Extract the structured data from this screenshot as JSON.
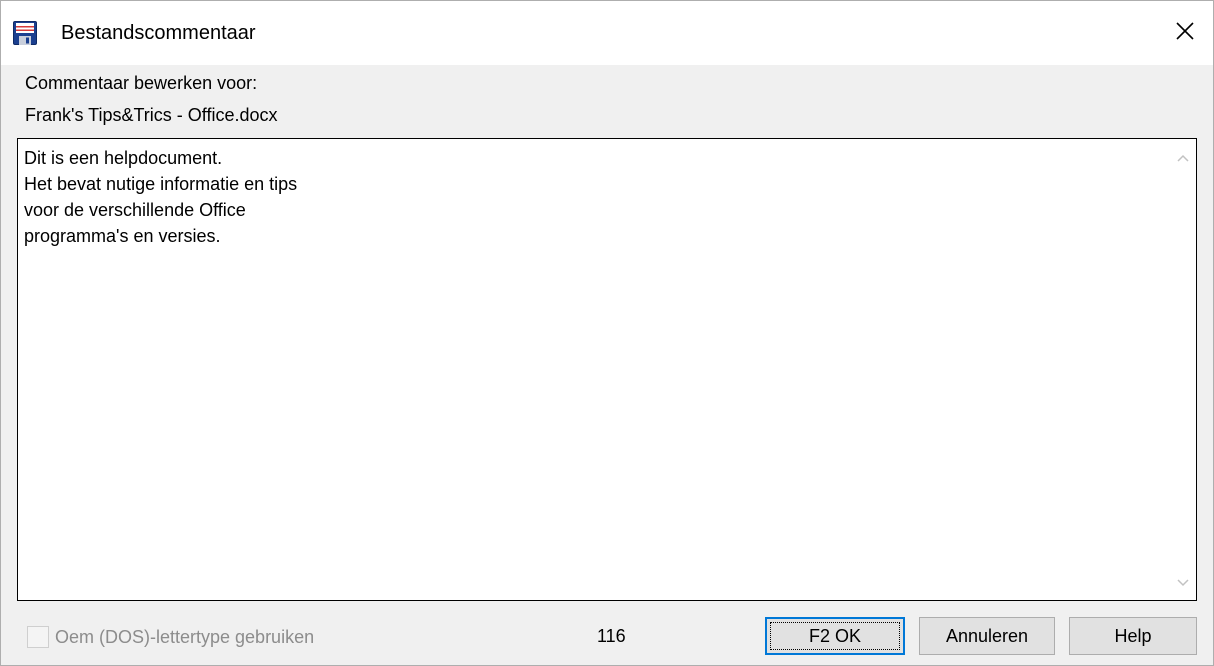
{
  "window": {
    "title": "Bestandscommentaar",
    "icon": "floppy-disk-icon",
    "close_icon": "close-icon"
  },
  "header": {
    "edit_label": "Commentaar bewerken voor:",
    "filename": "Frank's Tips&Trics - Office.docx"
  },
  "editor": {
    "text": "Dit is een helpdocument.\nHet bevat nutige informatie en tips\nvoor de verschillende Office\nprogramma's en versies."
  },
  "footer": {
    "oem_checkbox_label": "Oem (DOS)-lettertype gebruiken",
    "oem_checked": false,
    "oem_enabled": false,
    "char_count": "116",
    "ok_label": "F2 OK",
    "cancel_label": "Annuleren",
    "help_label": "Help"
  },
  "colors": {
    "accent": "#0078d7",
    "dialog_bg": "#f0f0f0",
    "disabled_text": "#8c8c8c"
  }
}
